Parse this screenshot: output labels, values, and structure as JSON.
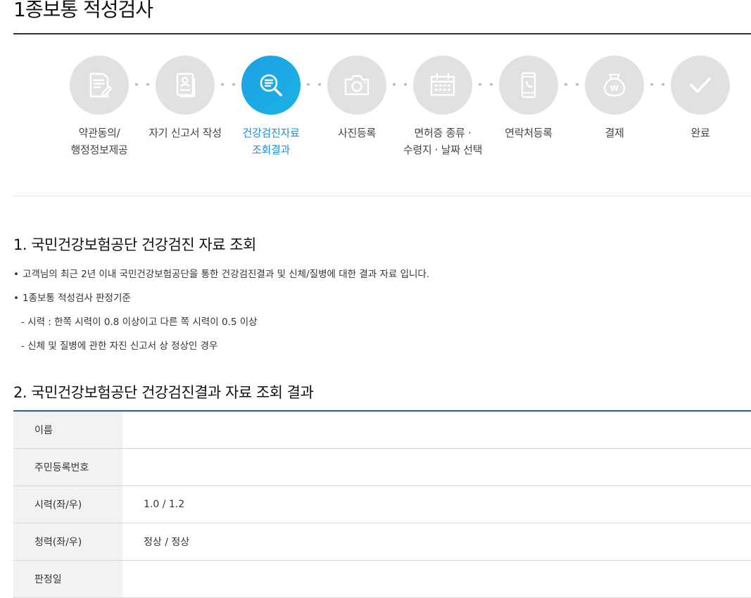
{
  "page": {
    "title": "1종보통 적성검사"
  },
  "steps": [
    {
      "icon": "document-sign-icon",
      "line1": "약관동의/",
      "line2": "행정정보제공"
    },
    {
      "icon": "self-report-icon",
      "line1": "자기 신고서 작성",
      "line2": ""
    },
    {
      "icon": "search-document-icon",
      "line1": "건강검진자료",
      "line2": "조회결과",
      "active": true
    },
    {
      "icon": "camera-icon",
      "line1": "사진등록",
      "line2": ""
    },
    {
      "icon": "calendar-icon",
      "line1": "면허증 종류 ·",
      "line2": "수령지 · 날짜 선택"
    },
    {
      "icon": "phone-icon",
      "line1": "연락처등록",
      "line2": ""
    },
    {
      "icon": "money-bag-icon",
      "line1": "결제",
      "line2": ""
    },
    {
      "icon": "check-icon",
      "line1": "완료",
      "line2": ""
    }
  ],
  "section1": {
    "title": "1. 국민건강보험공단 건강검진 자료 조회",
    "bullet1": "고객님의 최근 2년 이내 국민건강보험공단을 통한 건강검진결과 및 신체/질병에 대한 결과 자료 입니다.",
    "bullet2": "1종보통 적성검사 판정기준",
    "sub1": "- 시력 : 한쪽 시력이 0.8 이상이고 다른 쪽 시력이 0.5 이상",
    "sub2": "- 신체 및 질병에 관한 자진 신고서 상 정상인 경우"
  },
  "section2": {
    "title": "2. 국민건강보험공단 건강검진결과 자료 조회 결과",
    "rows": [
      {
        "label": "이름",
        "value": ""
      },
      {
        "label": "주민등록번호",
        "value": ""
      },
      {
        "label": "시력(좌/우)",
        "value": "1.0 / 1.2"
      },
      {
        "label": "청력(좌/우)",
        "value": "정상 / 정상"
      },
      {
        "label": "판정일",
        "value": ""
      }
    ]
  },
  "colors": {
    "active": "#1a9fe3",
    "inactive_circle": "#e1e1e1",
    "table_rule": "#2a5aa8"
  }
}
